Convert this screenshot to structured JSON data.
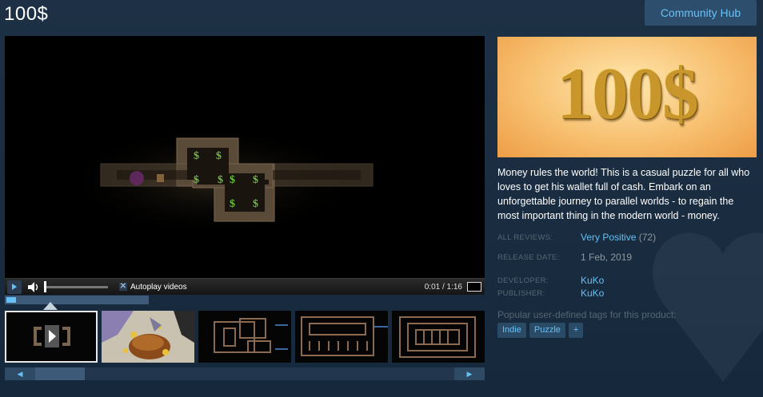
{
  "title": "100$",
  "community_hub_label": "Community Hub",
  "player": {
    "autoplay_label": "Autoplay videos",
    "time": "0:01 / 1:16",
    "volume_level": 0.0,
    "progress_fraction": 0.013
  },
  "capsule": {
    "logo_text": "100$"
  },
  "description": "Money rules the world! This is a casual puzzle for all who loves to get his wallet full of cash. Embark on an unforgettable journey to parallel worlds - to regain the most important thing in the modern world - money.",
  "meta": {
    "reviews_label": "ALL REVIEWS:",
    "reviews_value": "Very Positive",
    "reviews_count": "(72)",
    "release_label": "RELEASE DATE:",
    "release_value": "1 Feb, 2019",
    "developer_label": "DEVELOPER:",
    "developer_value": "KuKo",
    "publisher_label": "PUBLISHER:",
    "publisher_value": "KuKo"
  },
  "tags_label": "Popular user-defined tags for this product:",
  "tags": [
    "Indie",
    "Puzzle",
    "+"
  ],
  "colors": {
    "background": "#1b2d42",
    "accent": "#66c0f4",
    "hub_button": "#2e4e6e"
  },
  "icons": {
    "play": "play-icon",
    "volume": "volume-icon",
    "autoplay_check": "x-checkbox-icon",
    "fullscreen": "fullscreen-icon",
    "scroll_left": "left-arrow-icon",
    "scroll_right": "right-arrow-icon"
  }
}
